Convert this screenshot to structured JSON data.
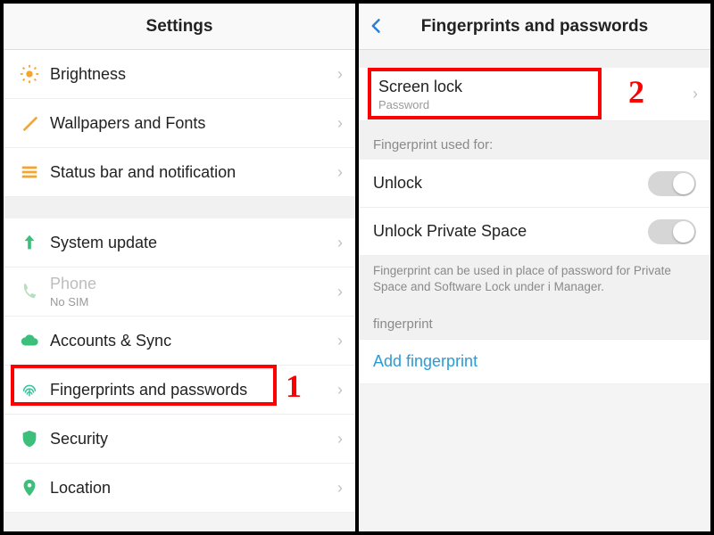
{
  "left": {
    "title": "Settings",
    "items": [
      {
        "label": "Brightness"
      },
      {
        "label": "Wallpapers and Fonts"
      },
      {
        "label": "Status bar and notification"
      }
    ],
    "items2": [
      {
        "label": "System update"
      },
      {
        "label": "Phone",
        "sub": "No SIM",
        "disabled": true
      },
      {
        "label": "Accounts & Sync"
      },
      {
        "label": "Fingerprints and passwords"
      },
      {
        "label": "Security"
      },
      {
        "label": "Location"
      }
    ],
    "step_num": "1"
  },
  "right": {
    "title": "Fingerprints and passwords",
    "screen_lock": {
      "label": "Screen lock",
      "value": "Password"
    },
    "section_head": "Fingerprint used for:",
    "toggles": [
      {
        "label": "Unlock"
      },
      {
        "label": "Unlock Private Space"
      }
    ],
    "note": "Fingerprint can be used in place of password for Private Space and Software Lock under i Manager.",
    "fp_head": "fingerprint",
    "add": "Add fingerprint",
    "step_num": "2"
  }
}
